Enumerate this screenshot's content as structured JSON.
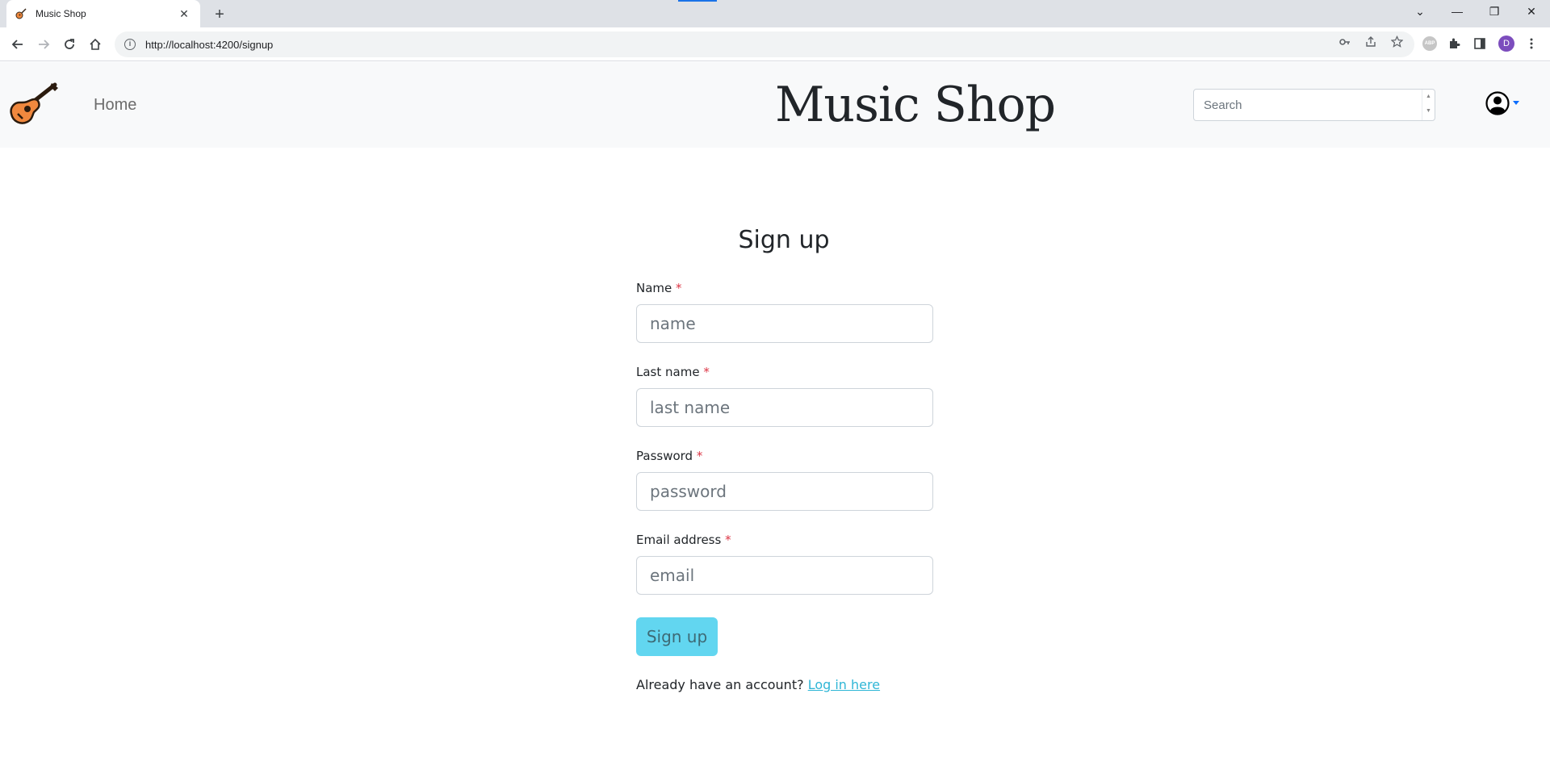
{
  "browser": {
    "tab_title": "Music Shop",
    "tab_close": "✕",
    "new_tab": "+",
    "url": "http://localhost:4200/signup",
    "profile_initial": "D",
    "window_controls": {
      "tabs": "⌄",
      "minimize": "—",
      "restore": "❐",
      "close": "✕"
    }
  },
  "navbar": {
    "home_label": "Home",
    "brand": "Music Shop",
    "search_placeholder": "Search"
  },
  "form": {
    "title": "Sign up",
    "required_mark": "*",
    "fields": [
      {
        "label": "Name",
        "placeholder": "name"
      },
      {
        "label": "Last name",
        "placeholder": "last name"
      },
      {
        "label": "Password",
        "placeholder": "password"
      },
      {
        "label": "Email address",
        "placeholder": "email"
      }
    ],
    "submit_label": "Sign up",
    "already_text": "Already have an account?",
    "login_link": "Log in here"
  },
  "colors": {
    "accent": "#62d6f0",
    "link": "#2fb6d6",
    "required": "#dc3545",
    "navbar_bg": "#f8f9fa",
    "profile": "#7c4dbd"
  },
  "icons": {
    "tab_favicon": "guitar-icon",
    "logo": "guitar-icon",
    "user": "user-circle-icon",
    "back": "back-arrow-icon",
    "forward": "forward-arrow-icon",
    "reload": "reload-icon",
    "home": "home-icon",
    "info": "info-icon",
    "key": "key-icon",
    "share": "share-icon",
    "star": "star-icon",
    "extensions": "puzzle-icon",
    "sidepanel": "side-panel-icon",
    "menu": "kebab-menu-icon"
  }
}
